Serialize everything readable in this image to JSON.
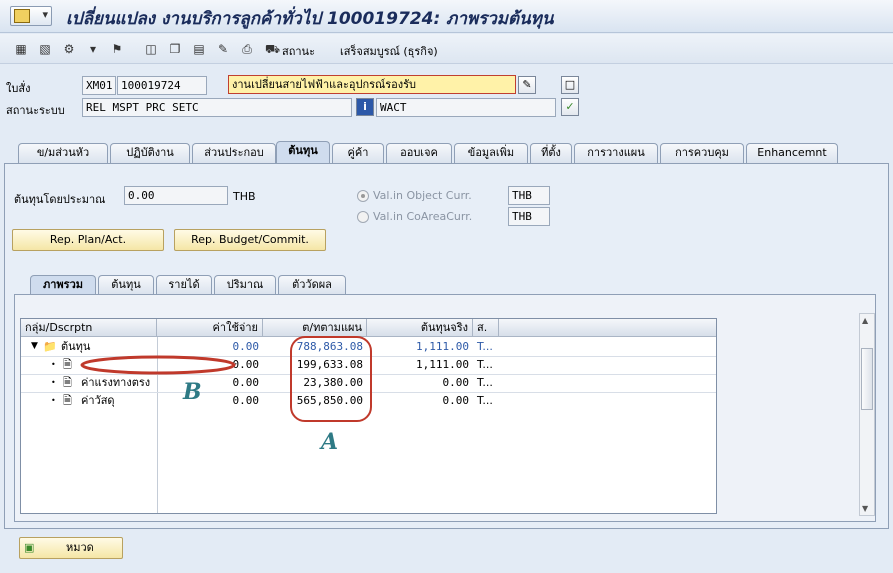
{
  "header": {
    "title": "เปลี่ยนแปลง งานบริการลูกค้าทั่วไป 100019724: ภาพรวมต้นทุน"
  },
  "toolbar": {
    "status_label": "สถานะ",
    "complete_label": "เสร็จสมบูรณ์ (ธุรกิจ)"
  },
  "header_fields": {
    "order_label": "ใบสั่ง",
    "order_type": "XM01",
    "order_number": "100019724",
    "description": "งานเปลี่ยนสายไฟฟ้าและอุปกรณ์รองรับ",
    "system_status_label": "สถานะระบบ",
    "system_status": "REL  MSPT PRC  SETC",
    "user_status": "WACT"
  },
  "tabs": [
    {
      "label": "ข/มส่วนหัว"
    },
    {
      "label": "ปฏิบัติงาน"
    },
    {
      "label": "ส่วนประกอบ"
    },
    {
      "label": "ต้นทุน"
    },
    {
      "label": "คู่ค้า"
    },
    {
      "label": "ออบเจค"
    },
    {
      "label": "ข้อมูลเพิ่ม"
    },
    {
      "label": "ที่ตั้ง"
    },
    {
      "label": "การวางแผน"
    },
    {
      "label": "การควบคุม"
    },
    {
      "label": "Enhancemnt"
    }
  ],
  "costs": {
    "estimated_label": "ต้นทุนโดยประมาณ",
    "estimated_value": "0.00",
    "currency": "THB",
    "radio_object_curr": "Val.in Object Curr.",
    "radio_object_curr_value": "THB",
    "radio_coarea_curr": "Val.in CoAreaCurr.",
    "radio_coarea_curr_value": "THB",
    "btn_plan_act": "Rep. Plan/Act.",
    "btn_budget": "Rep. Budget/Commit."
  },
  "subtabs": [
    {
      "label": "ภาพรวม"
    },
    {
      "label": "ต้นทุน"
    },
    {
      "label": "รายได้"
    },
    {
      "label": "ปริมาณ"
    },
    {
      "label": "ตัววัดผล"
    }
  ],
  "grid": {
    "headers": [
      "กลุ่ม/Dscrptn",
      "ค่าใช้จ่าย",
      "ต/ทตามแผน",
      "ต้นทุนจริง",
      "ส."
    ],
    "rows": [
      {
        "label": "ต้นทุน",
        "expense": "0.00",
        "plan": "788,863.08",
        "actual": "1,111.00",
        "s": "T..."
      },
      {
        "label": "",
        "expense": "0.00",
        "plan": "199,633.08",
        "actual": "1,111.00",
        "s": "T..."
      },
      {
        "label": "ค่าแรงทางตรง",
        "expense": "0.00",
        "plan": "23,380.00",
        "actual": "0.00",
        "s": "T..."
      },
      {
        "label": "ค่าวัสดุ",
        "expense": "0.00",
        "plan": "565,850.00",
        "actual": "0.00",
        "s": "T..."
      }
    ]
  },
  "annotations": {
    "a_label": "A",
    "b_label": "B",
    "color": "#c0392b"
  },
  "footer": {
    "category_button": "หมวด"
  }
}
